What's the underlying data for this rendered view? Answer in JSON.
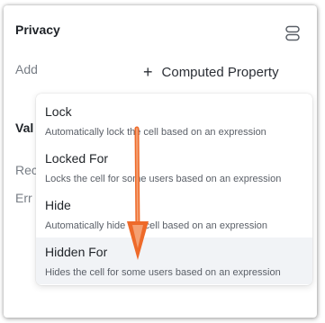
{
  "privacy": {
    "title": "Privacy",
    "add_label": "Add",
    "computed_property_label": "Computed Property"
  },
  "background_rows": [
    "Val",
    "Rec",
    "Err"
  ],
  "menu": {
    "items": [
      {
        "title": "Lock",
        "description": "Automatically lock the cell based on an expression"
      },
      {
        "title": "Locked For",
        "description": "Locks the cell for some users based on an expression"
      },
      {
        "title": "Hide",
        "description": "Automatically hide the cell based on an expression"
      },
      {
        "title": "Hidden For",
        "description": "Hides the cell for some users based on an expression"
      }
    ],
    "active_index": 3
  },
  "icons": {
    "database": "database-icon",
    "plus": "plus-icon",
    "annotation": "drag-arrow-annotation"
  },
  "colors": {
    "arrow_outer": "#ee6a2a",
    "arrow_inner": "#f4a072",
    "active_item_bg": "#f1f3f6"
  }
}
